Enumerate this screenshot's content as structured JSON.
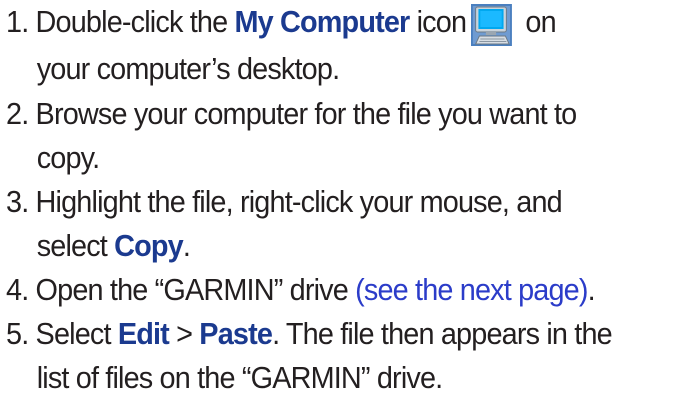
{
  "steps": [
    {
      "number": "1.",
      "pre": "Double-click the ",
      "bold": "My Computer",
      "mid": " icon",
      "post": " on",
      "line2": "your computer’s desktop.",
      "icon": "my-computer-icon"
    },
    {
      "number": "2.",
      "line1": "Browse your computer for the file you want to",
      "line2": "copy."
    },
    {
      "number": "3.",
      "line1": "Highlight the file, right-click your mouse, and",
      "line2_pre": "select ",
      "line2_bold": "Copy",
      "line2_post": "."
    },
    {
      "number": "4.",
      "pre": "Open the “GARMIN” drive ",
      "link": "(see the next page)",
      "post": "."
    },
    {
      "number": "5.",
      "pre": "Select ",
      "bold1": "Edit",
      "sep": " > ",
      "bold2": "Paste",
      "post": ". The file then appears in the",
      "line2": "list of files on the “GARMIN” drive."
    }
  ],
  "colors": {
    "text": "#231f20",
    "emphasis": "#1b3a8f",
    "link": "#2b3cc9"
  }
}
